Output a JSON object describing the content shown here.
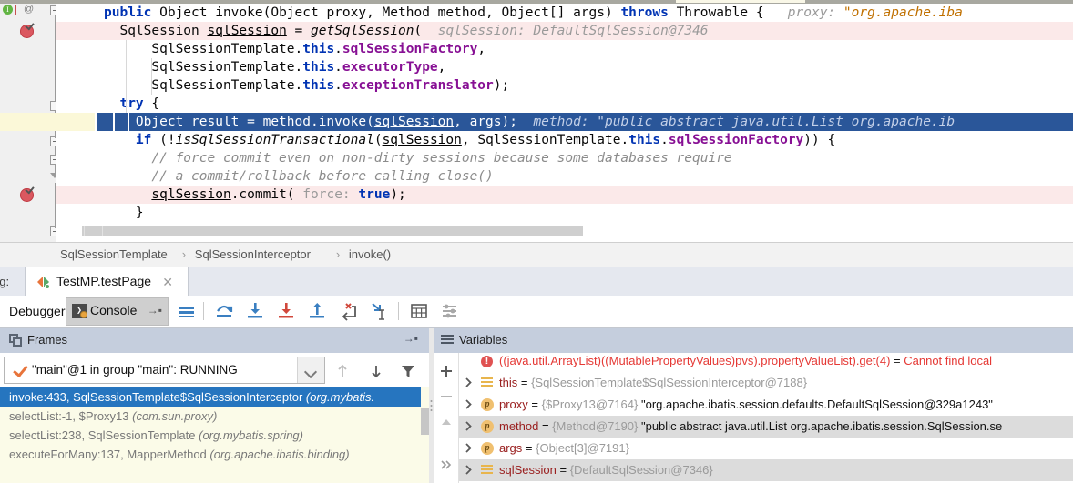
{
  "editor": {
    "code_lines": [
      {
        "id": "line1",
        "segments": [
          {
            "t": "public ",
            "c": "kw"
          },
          {
            "t": "Object ",
            "c": "plain"
          },
          {
            "t": "invoke",
            "c": "plain"
          },
          {
            "t": "(Object proxy, Method method, Object[] args) ",
            "c": "plain"
          },
          {
            "t": "throws ",
            "c": "kw"
          },
          {
            "t": "Throwable { ",
            "c": "plain"
          },
          {
            "t": "  proxy: ",
            "c": "hint"
          },
          {
            "t": "\"org.apache.iba",
            "c": "str"
          }
        ]
      },
      {
        "id": "line2",
        "segments": [
          {
            "t": "  SqlSession ",
            "c": "plain"
          },
          {
            "t": "sqlSession",
            "c": "und"
          },
          {
            "t": " = ",
            "c": "plain"
          },
          {
            "t": "getSqlSession",
            "c": "mth"
          },
          {
            "t": "(  ",
            "c": "plain"
          },
          {
            "t": "sqlSession: DefaultSqlSession@7346",
            "c": "hint"
          }
        ]
      },
      {
        "id": "line3",
        "segments": [
          {
            "t": "      SqlSessionTemplate.",
            "c": "plain"
          },
          {
            "t": "this",
            "c": "kw"
          },
          {
            "t": ".",
            "c": "plain"
          },
          {
            "t": "sqlSessionFactory",
            "c": "fld"
          },
          {
            "t": ",",
            "c": "plain"
          }
        ]
      },
      {
        "id": "line4",
        "segments": [
          {
            "t": "      SqlSessionTemplate.",
            "c": "plain"
          },
          {
            "t": "this",
            "c": "kw"
          },
          {
            "t": ".",
            "c": "plain"
          },
          {
            "t": "executorType",
            "c": "fld"
          },
          {
            "t": ",",
            "c": "plain"
          }
        ]
      },
      {
        "id": "line5",
        "segments": [
          {
            "t": "      SqlSessionTemplate.",
            "c": "plain"
          },
          {
            "t": "this",
            "c": "kw"
          },
          {
            "t": ".",
            "c": "plain"
          },
          {
            "t": "exceptionTranslator",
            "c": "fld"
          },
          {
            "t": ");",
            "c": "plain"
          }
        ]
      },
      {
        "id": "line6",
        "segments": [
          {
            "t": "  try",
            "c": "kw"
          },
          {
            "t": " {",
            "c": "plain"
          }
        ]
      },
      {
        "id": "line7",
        "segments": [
          {
            "t": "    Object result = method.invoke(",
            "c": "sel-txt"
          },
          {
            "t": "sqlSession",
            "c": "sel-txt und"
          },
          {
            "t": ", args);  ",
            "c": "sel-txt"
          },
          {
            "t": "method: \"public abstract java.util.List org.apache.ib",
            "c": "sel-hint"
          }
        ]
      },
      {
        "id": "line8",
        "segments": [
          {
            "t": "    if",
            "c": "kw"
          },
          {
            "t": " (!",
            "c": "plain"
          },
          {
            "t": "isSqlSessionTransactional",
            "c": "mth"
          },
          {
            "t": "(",
            "c": "plain"
          },
          {
            "t": "sqlSession",
            "c": "und"
          },
          {
            "t": ", SqlSessionTemplate.",
            "c": "plain"
          },
          {
            "t": "this",
            "c": "kw"
          },
          {
            "t": ".",
            "c": "plain"
          },
          {
            "t": "sqlSessionFactory",
            "c": "fld"
          },
          {
            "t": ")) {",
            "c": "plain"
          }
        ]
      },
      {
        "id": "line9",
        "segments": [
          {
            "t": "      // force commit even on non-dirty sessions because some databases require",
            "c": "cmt"
          }
        ]
      },
      {
        "id": "line10",
        "segments": [
          {
            "t": "      // a commit/rollback before calling close()",
            "c": "cmt"
          }
        ]
      },
      {
        "id": "line11",
        "segments": [
          {
            "t": "      ",
            "c": "plain"
          },
          {
            "t": "sqlSession",
            "c": "und"
          },
          {
            "t": ".commit( ",
            "c": "plain"
          },
          {
            "t": "force: ",
            "c": "hintn"
          },
          {
            "t": "true",
            "c": "kw"
          },
          {
            "t": ");",
            "c": "plain"
          }
        ]
      },
      {
        "id": "line12",
        "segments": [
          {
            "t": "    }",
            "c": "plain"
          }
        ]
      }
    ],
    "gutter": {
      "inherited_marker": "I",
      "annotation_marker": "@",
      "breakpoint_icon": "breakpoint-icon"
    }
  },
  "breadcrumb": {
    "items": [
      "SqlSessionTemplate",
      "SqlSessionInterceptor",
      "invoke()"
    ],
    "separator": "›"
  },
  "debug_window": {
    "label": "ug:",
    "tab": {
      "title": "TestMP.testPage",
      "close": "✕"
    },
    "toolbar": {
      "debugger_tab": "Debugger",
      "console_tab": "Console",
      "console_icon_char": "❯",
      "pin_glyph": "→▪",
      "buttons": [
        {
          "name": "show-execution-point",
          "label": "Show Execution Point"
        },
        {
          "name": "step-over",
          "label": "Step Over"
        },
        {
          "name": "step-into",
          "label": "Step Into"
        },
        {
          "name": "force-step-into",
          "label": "Force Step Into"
        },
        {
          "name": "step-out",
          "label": "Step Out"
        },
        {
          "name": "drop-frame",
          "label": "Drop Frame"
        },
        {
          "name": "run-to-cursor",
          "label": "Run to Cursor"
        },
        {
          "name": "evaluate-expression",
          "label": "Evaluate Expression"
        },
        {
          "name": "settings",
          "label": "Layout Settings"
        }
      ]
    }
  },
  "frames": {
    "header": "Frames",
    "pin_glyph": "→▪",
    "thread": "\"main\"@1 in group \"main\": RUNNING",
    "list": [
      {
        "text": "invoke:433, SqlSessionTemplate$SqlSessionInterceptor ",
        "pkg": "(org.mybatis.",
        "selected": true
      },
      {
        "text": "selectList:-1, $Proxy13 ",
        "pkg": "(com.sun.proxy)",
        "selected": false
      },
      {
        "text": "selectList:238, SqlSessionTemplate ",
        "pkg": "(org.mybatis.spring)",
        "selected": false
      },
      {
        "text": "executeForMany:137, MapperMethod ",
        "pkg": "(org.apache.ibatis.binding)",
        "selected": false
      }
    ],
    "buttons": [
      {
        "name": "frame-up-button",
        "label": "Up"
      },
      {
        "name": "frame-down-button",
        "label": "Down"
      },
      {
        "name": "frames-filter-button",
        "label": "Filter"
      }
    ]
  },
  "variables": {
    "header": "Variables",
    "sidebar_buttons": [
      {
        "name": "add-watch-button",
        "label": "+"
      },
      {
        "name": "remove-watch-button",
        "label": "−"
      },
      {
        "name": "scroll-up-button",
        "label": "▲"
      },
      {
        "name": "expand-more-button",
        "label": "»"
      }
    ],
    "rows": [
      {
        "icon": "error-icon",
        "arrow": false,
        "name": "((java.util.ArrayList)((MutablePropertyValues)pvs).propertyValueList).get(4)",
        "name_class": "v-errname",
        "eq": " = ",
        "value": "Cannot find local",
        "value_class": "v-err",
        "hover": false
      },
      {
        "icon": "field-icon",
        "arrow": true,
        "name": "this",
        "name_class": "v-name",
        "eq": " = ",
        "value": "{SqlSessionTemplate$SqlSessionInterceptor@7188}",
        "value_class": "v-ref",
        "hover": false
      },
      {
        "icon": "param-icon",
        "arrow": true,
        "name": "proxy",
        "name_class": "v-name",
        "eq": " = ",
        "value": "{$Proxy13@7164} ",
        "value_class": "v-ref",
        "value2": "\"org.apache.ibatis.session.defaults.DefaultSqlSession@329a1243\"",
        "value2_class": "v-str",
        "hover": false
      },
      {
        "icon": "param-icon",
        "arrow": true,
        "name": "method",
        "name_class": "v-name",
        "eq": " = ",
        "value": "{Method@7190} ",
        "value_class": "v-ref",
        "value2": "\"public abstract java.util.List org.apache.ibatis.session.SqlSession.se",
        "value2_class": "v-str",
        "hover": true
      },
      {
        "icon": "param-icon",
        "arrow": true,
        "name": "args",
        "name_class": "v-name",
        "eq": " = ",
        "value": "{Object[3]@7191}",
        "value_class": "v-ref",
        "hover": false
      },
      {
        "icon": "field-icon",
        "arrow": true,
        "name": "sqlSession",
        "name_class": "v-name",
        "eq": " = ",
        "value": "{DefaultSqlSession@7346}",
        "value_class": "v-ref",
        "hover": true
      }
    ]
  },
  "colors": {
    "selection_blue": "#2a5699",
    "frame_selection": "#2675bf",
    "panel_header": "#c5cedd",
    "breakpoint_red": "#db5860",
    "error_red": "#e53935",
    "keyword_blue": "#0033b3",
    "field_purple": "#871094",
    "comment_gray": "#8c8c8c",
    "string_orange": "#c07000",
    "frames_bg": "#fbfbe8"
  }
}
